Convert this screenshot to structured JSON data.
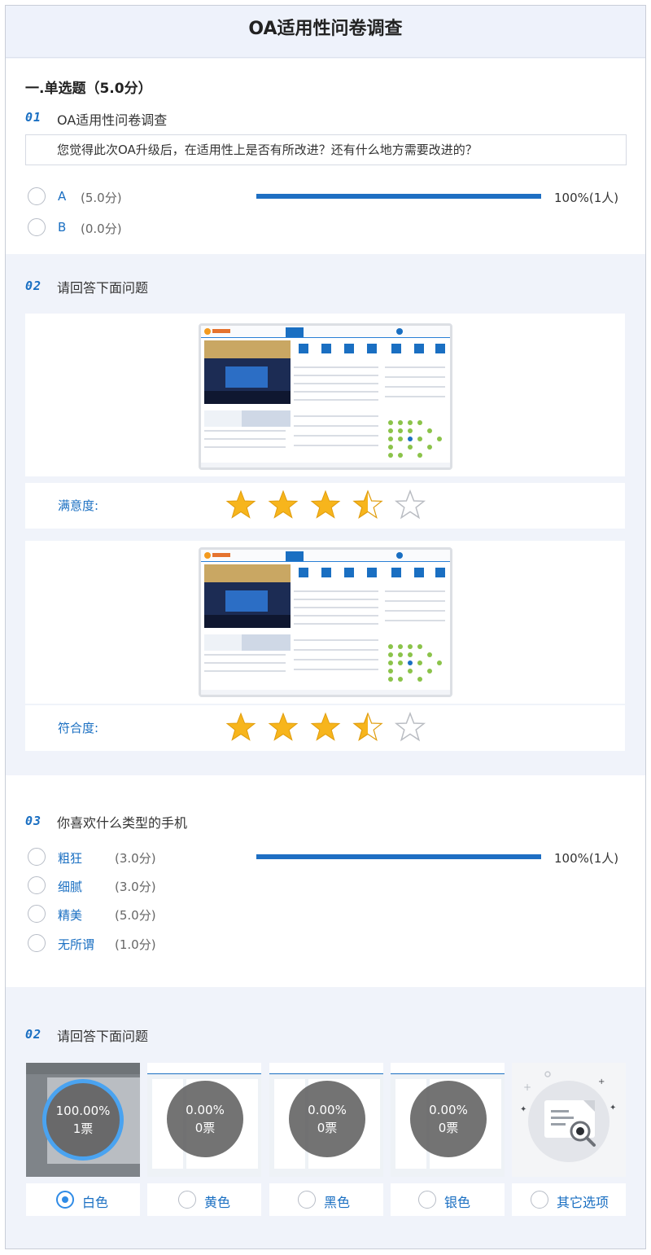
{
  "page": {
    "title": "OA适用性问卷调查"
  },
  "section1": {
    "title": "一.单选题（5.0分）"
  },
  "q1": {
    "num": "01",
    "text": "OA适用性问卷调查",
    "desc": "您觉得此次OA升级后，在适用性上是否有所改进？还有什么地方需要改进的？",
    "options": [
      {
        "label": "A",
        "score": "(5.0分)",
        "percent": "100%(1人)",
        "fill": 1.0
      },
      {
        "label": "B",
        "score": "(0.0分)"
      }
    ]
  },
  "q2": {
    "num": "02",
    "text": "请回答下面问题",
    "ratings": [
      {
        "label": "满意度:",
        "stars": 3.5,
        "max": 5
      },
      {
        "label": "符合度:",
        "stars": 3.5,
        "max": 5
      }
    ]
  },
  "q3": {
    "num": "03",
    "text": "你喜欢什么类型的手机",
    "options": [
      {
        "label": "粗狂",
        "score": "(3.0分)",
        "percent": "100%(1人)",
        "fill": 1.0
      },
      {
        "label": "细腻",
        "score": "(3.0分)"
      },
      {
        "label": "精美",
        "score": "(5.0分)"
      },
      {
        "label": "无所谓",
        "score": "(1.0分)"
      }
    ]
  },
  "q4": {
    "num": "02",
    "text": "请回答下面问题",
    "choices": [
      {
        "label": "白色",
        "percent": "100.00%",
        "votes": "1票",
        "selected": true
      },
      {
        "label": "黄色",
        "percent": "0.00%",
        "votes": "0票",
        "selected": false
      },
      {
        "label": "黑色",
        "percent": "0.00%",
        "votes": "0票",
        "selected": false
      },
      {
        "label": "银色",
        "percent": "0.00%",
        "votes": "0票",
        "selected": false
      },
      {
        "label": "其它选项",
        "selected": false
      }
    ]
  },
  "mockup": {
    "brand": "九尺科技",
    "tabs": [
      "新闻中心",
      "热点新闻",
      "工作汇报",
      "下属汇报",
      "我的邮件",
      "通知中心"
    ],
    "calendar_month": "2017/06",
    "banner_text": "九尺(上)开放助力企业(1/17)互联和OA大会"
  },
  "colors": {
    "accent": "#1a6fc2",
    "bar": "#1e6fc3",
    "star": "#f7b51c",
    "radio_selected": "#2f8be6"
  }
}
